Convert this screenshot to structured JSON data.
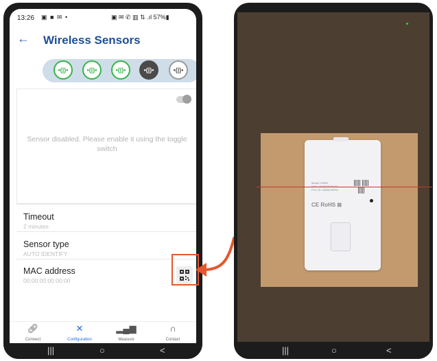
{
  "status_bar": {
    "time": "13:26",
    "left_icons": "▣ ■ ✉ •",
    "right_icons": "▣ ✉ ✆ ▥ ⇅ .ıl 57%▮"
  },
  "app": {
    "back_icon": "arrow-left-icon",
    "title": "Wireless Sensors"
  },
  "sensors": [
    {
      "symbol": "•(|)•"
    },
    {
      "symbol": "•(|)•"
    },
    {
      "symbol": "•(|)•"
    },
    {
      "symbol": "•(|)•"
    },
    {
      "symbol": "•(|)•"
    }
  ],
  "sensor_card": {
    "message": "Sensor disabled. Please enable it using the toggle switch",
    "toggle_state": "off"
  },
  "settings": [
    {
      "label": "Timeout",
      "value": "2 minutes"
    },
    {
      "label": "Sensor type",
      "value": "AUTO IDENTIFY"
    },
    {
      "label": "MAC address",
      "value": "00:00:00:00:00:00"
    }
  ],
  "bottom_nav": [
    {
      "label": "Connect",
      "icon": "link-icon"
    },
    {
      "label": "Configuration",
      "icon": "tools-icon",
      "active": true
    },
    {
      "label": "Measure",
      "icon": "chart-icon"
    },
    {
      "label": "Contact",
      "icon": "headset-icon"
    }
  ],
  "android_nav": {
    "recent": "|||",
    "home": "○",
    "back": "<"
  },
  "device_label": {
    "lines": [
      "Model: WSN1",
      "MAC: 00:00:00:00:00",
      "FCC ID: 2AW8-WSN1"
    ],
    "marks": "CE RoHS ⊠"
  },
  "colors": {
    "accent": "#1e4f96",
    "sensor_active": "#35b548",
    "nav_active": "#1c6fd6",
    "highlight": "#e4572e",
    "scan_line": "#c0392b"
  }
}
